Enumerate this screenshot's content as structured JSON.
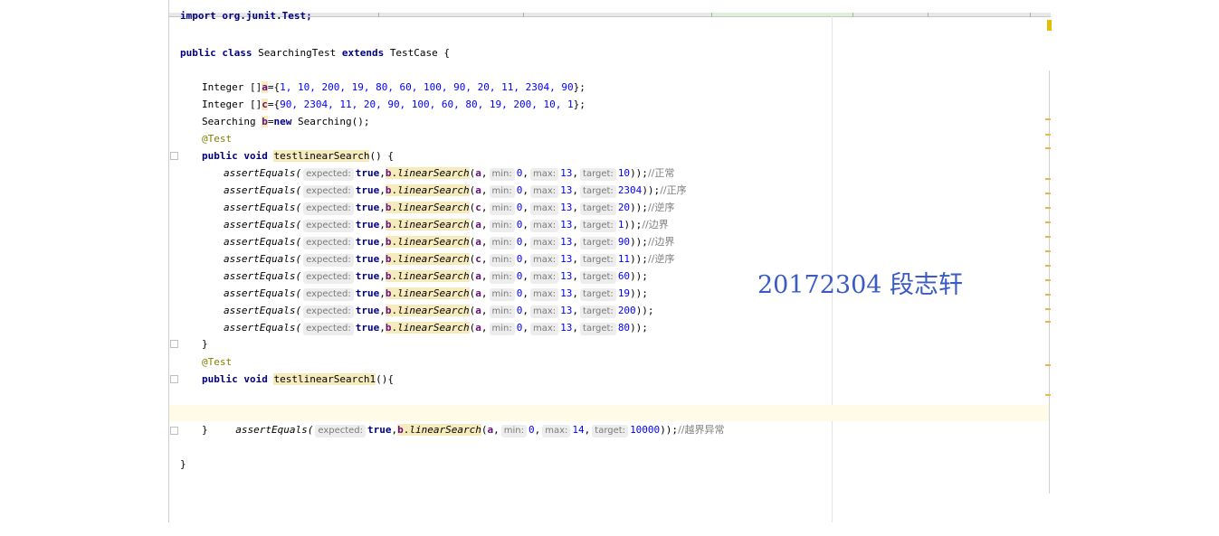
{
  "editor": {
    "lines": {
      "import_line": "import org.junit.Test;",
      "class_decl_kw1": "public class",
      "class_name": "SearchingTest",
      "class_decl_kw2": "extends",
      "class_parent": "TestCase {",
      "arr_a": {
        "type": "Integer []",
        "name": "a",
        "values": "1, 10, 200, 19, 80, 60, 100, 90, 20, 11, 2304, 90"
      },
      "arr_c": {
        "type": "Integer []",
        "name": "c",
        "values": "90, 2304, 11, 20, 90, 100, 60, 80, 19, 200, 10, 1"
      },
      "searching": {
        "type": "Searching",
        "name": "b",
        "new_kw": "new",
        "ctor": "Searching();"
      },
      "annotation": "@Test",
      "method1": {
        "kw": "public void",
        "name": "testlinearSearch",
        "tail": "() {"
      },
      "method2": {
        "kw": "public void",
        "name": "testlinearSearch1",
        "tail": "(){"
      },
      "close_brace": "}",
      "class_close": "}"
    },
    "assert_calls": [
      {
        "arr": "a",
        "max": "13",
        "target": "10",
        "comment": "//正常"
      },
      {
        "arr": "a",
        "max": "13",
        "target": "2304",
        "comment": "//正序"
      },
      {
        "arr": "c",
        "max": "13",
        "target": "20",
        "comment": "//逆序"
      },
      {
        "arr": "a",
        "max": "13",
        "target": "1",
        "comment": "//边界"
      },
      {
        "arr": "a",
        "max": "13",
        "target": "90",
        "comment": "//边界"
      },
      {
        "arr": "c",
        "max": "13",
        "target": "11",
        "comment": "//逆序"
      },
      {
        "arr": "a",
        "max": "13",
        "target": "60",
        "comment": ""
      },
      {
        "arr": "a",
        "max": "13",
        "target": "19",
        "comment": ""
      },
      {
        "arr": "a",
        "max": "13",
        "target": "200",
        "comment": ""
      },
      {
        "arr": "a",
        "max": "13",
        "target": "80",
        "comment": ""
      }
    ],
    "assert_call_2": {
      "arr": "a",
      "max": "14",
      "target": "10000",
      "comment": "//越界异常"
    },
    "tokens": {
      "assert": "assertEquals(",
      "expected_hint": "expected:",
      "true_kw": "true",
      "b_ref": "b",
      "method": "linearSearch",
      "min_hint": "min:",
      "min_val": "0",
      "max_hint": "max:",
      "target_hint": "target:",
      "end_call": "));"
    }
  },
  "watermark": "20172304 段志轩",
  "colors": {
    "keyword": "#000080",
    "number": "#0000ff",
    "annotation": "#808000",
    "field": "#660e7a",
    "watermark": "#3a5bc4"
  }
}
